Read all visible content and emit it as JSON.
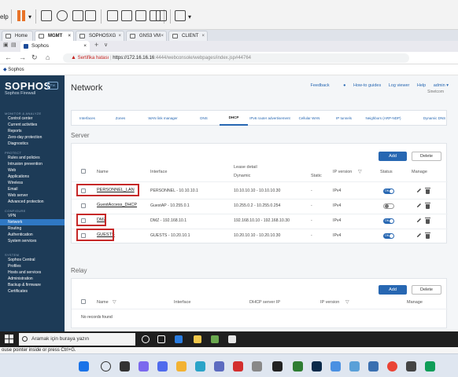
{
  "vm_toolbar": {
    "help_fragment": "elp"
  },
  "browser_tabs": [
    {
      "label": "Home",
      "active": false
    },
    {
      "label": "MGMT",
      "active": true
    },
    {
      "label": "SOPHOSXG",
      "active": false
    },
    {
      "label": "GNS3 VM",
      "active": false
    },
    {
      "label": "CLIENT",
      "active": false
    }
  ],
  "page_tab": {
    "label": "Sophos"
  },
  "address": {
    "warning": "Sertifika hatası",
    "host": "https://172.16.16.16",
    "rest": ":4444/webconsole/webpages/index.jsp#44764"
  },
  "bookmark": "Sophos",
  "sidebar": {
    "brand": "SOPHOS",
    "product": "Sophos Firewall",
    "badge": "Fw",
    "sections": [
      {
        "title": "MONITOR & ANALYZE",
        "items": [
          "Control center",
          "Current activities",
          "Reports",
          "Zero-day protection",
          "Diagnostics"
        ]
      },
      {
        "title": "PROTECT",
        "items": [
          "Rules and policies",
          "Intrusion prevention",
          "Web",
          "Applications",
          "Wireless",
          "Email",
          "Web server",
          "Advanced protection"
        ]
      },
      {
        "title": "CONFIGURE",
        "items": [
          "VPN",
          "Network",
          "Routing",
          "Authentication",
          "System services"
        ]
      },
      {
        "title": "SYSTEM",
        "items": [
          "Sophos Central",
          "Profiles",
          "Hosts and services",
          "Administration",
          "Backup & firmware",
          "Certificates"
        ]
      }
    ],
    "active_item": "Network"
  },
  "header": {
    "title": "Network",
    "links": [
      "Feedback",
      "How-to guides",
      "Log viewer",
      "Help",
      "admin ▾"
    ],
    "org": "Sinetcom"
  },
  "subtabs": [
    "Interfaces",
    "Zones",
    "WAN link manager",
    "DNS",
    "DHCP",
    "IPv6 router advertisement",
    "Cellular WAN",
    "IP tunnels",
    "Neighbors (ARP-NDP)",
    "Dynamic DNS"
  ],
  "active_subtab": "DHCP",
  "server": {
    "title": "Server",
    "add_label": "Add",
    "delete_label": "Delete",
    "headers": {
      "name": "Name",
      "interface": "Interface",
      "lease_detail": "Lease detail",
      "dynamic": "Dynamic",
      "static": "Static",
      "ip_version": "IP version",
      "status": "Status",
      "manage": "Manage"
    },
    "rows": [
      {
        "name": "PERSONNEL_LAN",
        "interface": "PERSONNEL - 10.10.10.1",
        "dynamic": "10.10.10.10 - 10.10.10.30",
        "static": "-",
        "ip_version": "IPv4",
        "status": "on",
        "highlight": true
      },
      {
        "name": "GuestAccess_DHCP",
        "interface": "GuestAP - 10.255.0.1",
        "dynamic": "10.255.0.2 - 10.255.0.254",
        "static": "-",
        "ip_version": "IPv4",
        "status": "off",
        "highlight": false
      },
      {
        "name": "DMZ",
        "interface": "DMZ - 192.168.10.1",
        "dynamic": "192.168.10.10 - 192.168.10.30",
        "static": "-",
        "ip_version": "IPv4",
        "status": "on",
        "highlight": true
      },
      {
        "name": "GUESTS",
        "interface": "GUESTS - 10.20.10.1",
        "dynamic": "10.20.10.10 - 10.20.10.30",
        "static": "-",
        "ip_version": "IPv4",
        "status": "on",
        "highlight": true
      }
    ],
    "toggle_on_label": "ON"
  },
  "relay": {
    "title": "Relay",
    "add_label": "Add",
    "delete_label": "Delete",
    "headers": {
      "name": "Name",
      "interface": "Interface",
      "dhcp_server_ip": "DHCP server IP",
      "ip_version": "IP version",
      "manage": "Manage"
    },
    "empty_text": "No records found"
  },
  "vm_taskbar": {
    "search_placeholder": "Aramak için buraya yazın"
  },
  "status_hint": "ouse pointer inside or press Ctrl+G.",
  "colors": {
    "sidebar": "#1d3b57",
    "accent": "#2767b2",
    "highlight": "#c62828"
  }
}
